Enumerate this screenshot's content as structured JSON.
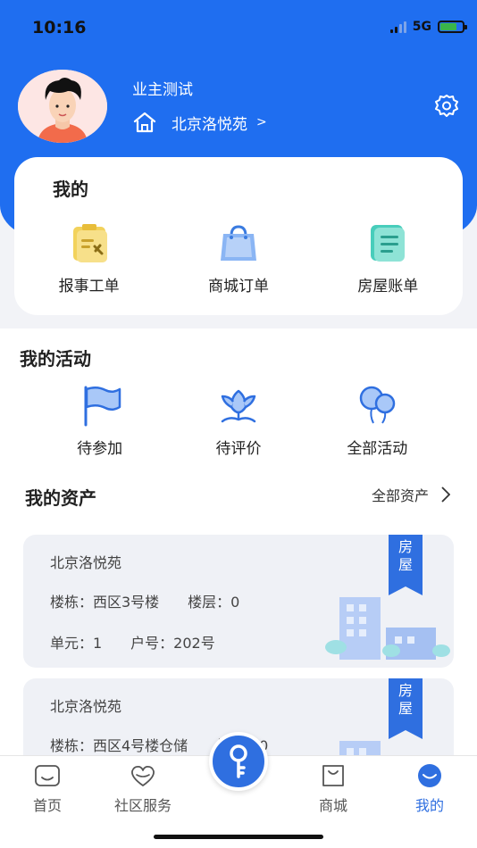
{
  "status_bar": {
    "time": "10:16",
    "network": "5G"
  },
  "profile": {
    "name": "业主测试",
    "community": "北京洛悦苑",
    "chevron": ">"
  },
  "my_card": {
    "title": "我的",
    "items": [
      {
        "label": "报事工单",
        "icon": "report-ticket-icon"
      },
      {
        "label": "商城订单",
        "icon": "shopping-bag-icon"
      },
      {
        "label": "房屋账单",
        "icon": "bill-icon"
      }
    ]
  },
  "activities": {
    "title": "我的活动",
    "items": [
      {
        "label": "待参加",
        "icon": "flag-icon"
      },
      {
        "label": "待评价",
        "icon": "lotus-icon"
      },
      {
        "label": "全部活动",
        "icon": "balloons-icon"
      }
    ]
  },
  "assets": {
    "title": "我的资产",
    "all_label": "全部资产",
    "cards": [
      {
        "name": "北京洛悦苑",
        "tag": [
          "房",
          "屋"
        ],
        "line1": "楼栋：西区3号楼　　楼层：0",
        "line2": "单元：1　　户号：202号"
      },
      {
        "name": "北京洛悦苑",
        "tag": [
          "房",
          "屋"
        ],
        "line1": "楼栋：西区4号楼仓储　　楼层：0"
      }
    ]
  },
  "tabbar": {
    "items": [
      {
        "label": "首页"
      },
      {
        "label": "社区服务"
      },
      {
        "label": "商城"
      },
      {
        "label": "我的"
      }
    ]
  },
  "colors": {
    "brand": "#1f6ef0",
    "accent": "#2f6fe0"
  }
}
